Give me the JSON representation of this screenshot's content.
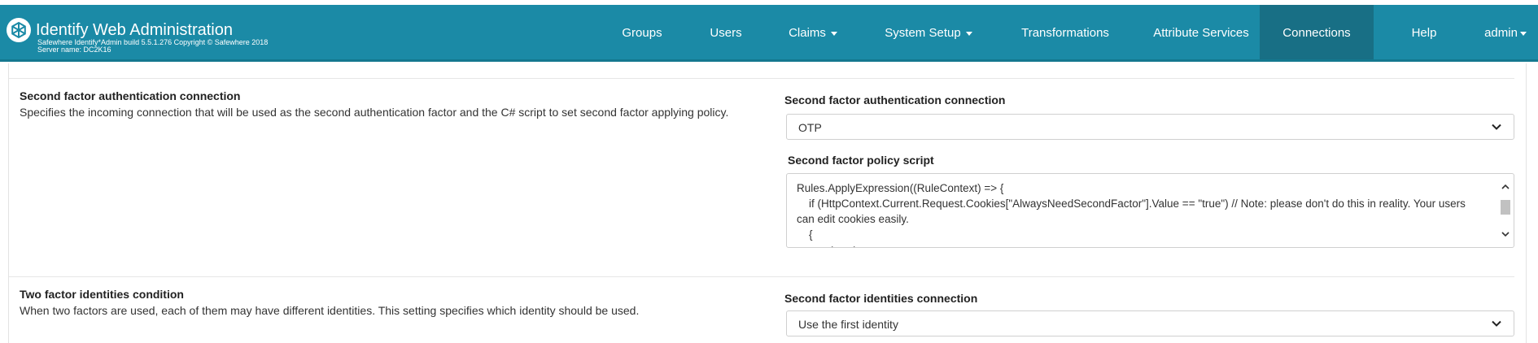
{
  "header": {
    "title": "Identify Web Administration",
    "build": "Safewhere Identify*Admin build 5.5.1.276 Copyright © Safewhere 2018",
    "server": "Server name: DC2K16",
    "nav": {
      "groups": "Groups",
      "users": "Users",
      "claims": "Claims",
      "system_setup": "System Setup",
      "transformations": "Transformations",
      "attribute_services": "Attribute Services",
      "connections": "Connections",
      "help": "Help",
      "admin": "admin"
    },
    "colors": {
      "navbar": "#1b8aa6",
      "active": "#186f85"
    }
  },
  "second_factor": {
    "title": "Second factor authentication connection",
    "description": "Specifies the incoming connection that will be used as the second authentication factor and the C# script to set second factor applying policy.",
    "connection_label": "Second factor authentication connection",
    "connection_value": "OTP",
    "policy_label": "Second factor policy script",
    "policy_script": "Rules.ApplyExpression((RuleContext) => {\n    if (HttpContext.Current.Request.Cookies[\"AlwaysNeedSecondFactor\"].Value == \"true\") // Note: please don't do this in reality. Your users can edit cookies easily.\n    {\n        return true;"
  },
  "two_factor": {
    "title": "Two factor identities condition",
    "description": "When two factors are used, each of them may have different identities. This setting specifies which identity should be used.",
    "connection_label": "Second factor identities connection",
    "connection_value": "Use the first identity"
  }
}
